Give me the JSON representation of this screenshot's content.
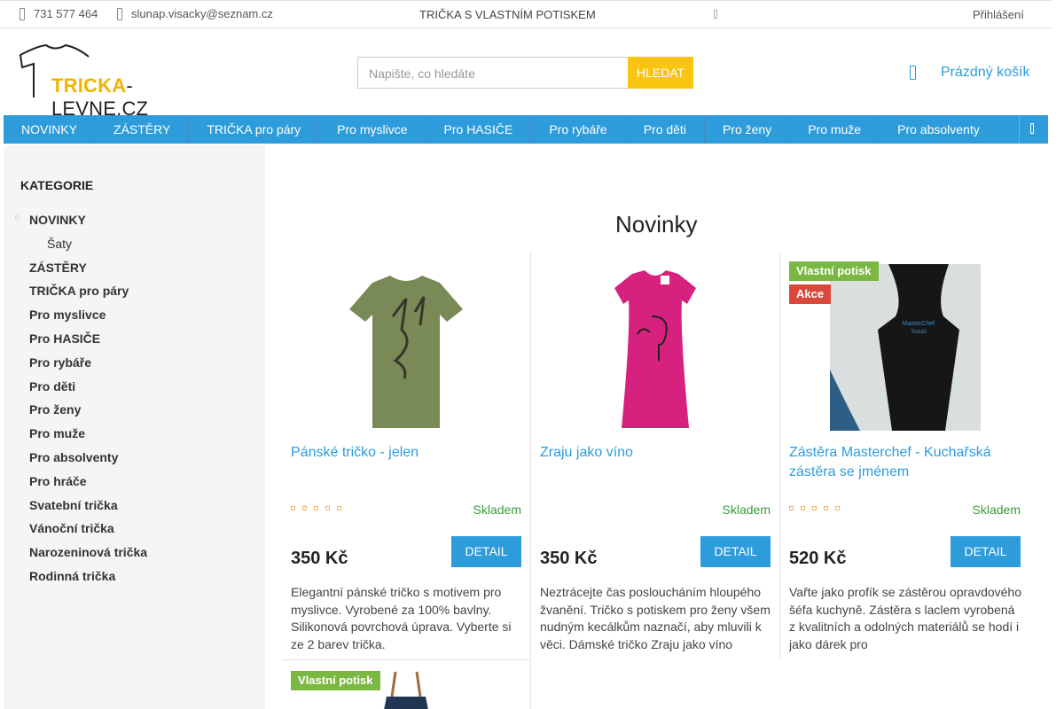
{
  "topbar": {
    "phone": "731 577 464",
    "email": "slunap.visacky@seznam.cz",
    "headline": "TRIČKA S VLASTNÍM POTISKEM",
    "login": "Přihlášení"
  },
  "logo": {
    "part1": "TRICKA",
    "part2": "-LEVNE.CZ"
  },
  "search": {
    "placeholder": "Napište, co hledáte",
    "button": "HLEDAT"
  },
  "cart": {
    "label": "Prázdný košík"
  },
  "nav": {
    "items": [
      "NOVINKY",
      "ZÁSTĚRY",
      "TRIČKA pro páry",
      "Pro myslivce",
      "Pro HASIČE",
      "Pro rybáře",
      "Pro děti",
      "Pro ženy",
      "Pro muže",
      "Pro absolventy"
    ]
  },
  "sidebar": {
    "heading": "KATEGORIE",
    "items": [
      {
        "label": "NOVINKY",
        "sub": false
      },
      {
        "label": "Šaty",
        "sub": true
      },
      {
        "label": "ZÁSTĚRY",
        "sub": false
      },
      {
        "label": "TRIČKA pro páry",
        "sub": false
      },
      {
        "label": "Pro myslivce",
        "sub": false
      },
      {
        "label": "Pro HASIČE",
        "sub": false
      },
      {
        "label": "Pro rybáře",
        "sub": false
      },
      {
        "label": "Pro děti",
        "sub": false
      },
      {
        "label": "Pro ženy",
        "sub": false
      },
      {
        "label": "Pro muže",
        "sub": false
      },
      {
        "label": "Pro absolventy",
        "sub": false
      },
      {
        "label": "Pro hráče",
        "sub": false
      },
      {
        "label": "Svatební trička",
        "sub": false
      },
      {
        "label": "Vánoční trička",
        "sub": false
      },
      {
        "label": "Narozeninová trička",
        "sub": false
      },
      {
        "label": "Rodinná trička",
        "sub": false
      }
    ]
  },
  "main": {
    "title": "Novinky"
  },
  "products": [
    {
      "name": "Pánské tričko - jelen",
      "stock": "Skladem",
      "price": "350 Kč",
      "detail": "DETAIL",
      "desc": "Elegantní pánské tričko s motivem pro myslivce. Vyrobené za 100% bavlny. Silikonová povrchová úprava. Vyberte si ze 2 barev trička."
    },
    {
      "name": "Zraju jako víno",
      "stock": "Skladem",
      "price": "350 Kč",
      "detail": "DETAIL",
      "desc": "Neztrácejte čas posloucháním hloupého žvanění. Tričko s potiskem pro ženy všem nudným kecálkům naznačí, aby mluvili k věci. Dámské tričko Zraju jako víno"
    },
    {
      "name": "Zástěra Masterchef - Kuchařská zástěra se jménem",
      "stock": "Skladem",
      "price": "520 Kč",
      "detail": "DETAIL",
      "badges": [
        "Vlastní potisk",
        "Akce"
      ],
      "desc": "Vařte jako profík se zástěrou opravdového šéfa kuchyně. Zástěra s laclem vyrobená z kvalitních a odolných materiálů se hodí i jako dárek pro"
    }
  ],
  "product4": {
    "badge": "Vlastní potisk"
  }
}
